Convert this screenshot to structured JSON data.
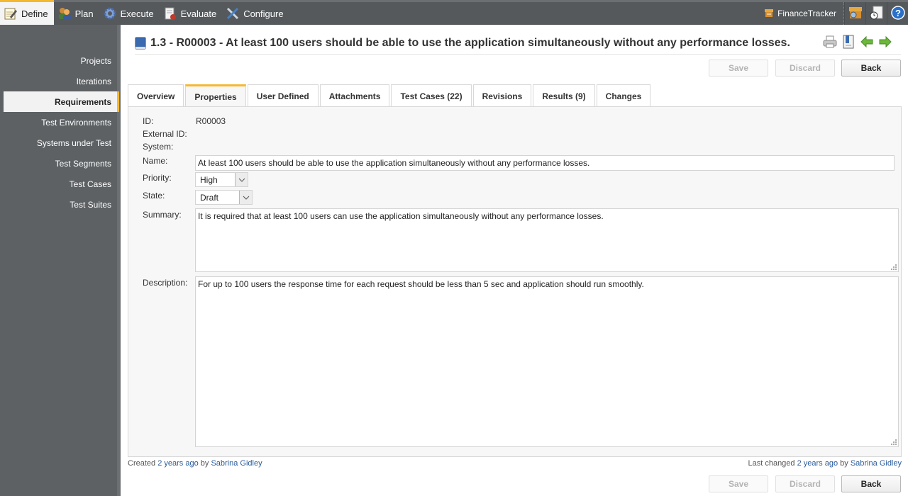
{
  "topnav": {
    "items": [
      {
        "label": "Define",
        "icon": "notepad-pencil-icon",
        "active": true
      },
      {
        "label": "Plan",
        "icon": "people-icon",
        "active": false
      },
      {
        "label": "Execute",
        "icon": "gear-icon",
        "active": false
      },
      {
        "label": "Evaluate",
        "icon": "report-chart-icon",
        "active": false
      },
      {
        "label": "Configure",
        "icon": "tools-icon",
        "active": false
      }
    ],
    "project": "FinanceTracker",
    "right_icons": [
      "project-search-icon",
      "history-document-icon",
      "help-icon"
    ]
  },
  "sidebar": {
    "items": [
      {
        "label": "Projects",
        "active": false
      },
      {
        "label": "Iterations",
        "active": false
      },
      {
        "label": "Requirements",
        "active": true
      },
      {
        "label": "Test Environments",
        "active": false
      },
      {
        "label": "Systems under Test",
        "active": false
      },
      {
        "label": "Test Segments",
        "active": false
      },
      {
        "label": "Test Cases",
        "active": false
      },
      {
        "label": "Test Suites",
        "active": false
      }
    ]
  },
  "header": {
    "title": "1.3 - R00003 - At least 100 users should be able to use the application simultaneously without any performance losses.",
    "tools": [
      "printer-icon",
      "bookmark-document-icon",
      "previous-arrow-icon",
      "next-arrow-icon"
    ]
  },
  "actions": {
    "save": "Save",
    "discard": "Discard",
    "back": "Back"
  },
  "tabs": [
    {
      "label": "Overview",
      "active": false
    },
    {
      "label": "Properties",
      "active": true
    },
    {
      "label": "User Defined",
      "active": false
    },
    {
      "label": "Attachments",
      "active": false
    },
    {
      "label": "Test Cases (22)",
      "active": false
    },
    {
      "label": "Revisions",
      "active": false
    },
    {
      "label": "Results (9)",
      "active": false
    },
    {
      "label": "Changes",
      "active": false
    }
  ],
  "form": {
    "id_label": "ID:",
    "id_value": "R00003",
    "external_id_label": "External ID:",
    "external_id_value": "",
    "system_label": "System:",
    "system_value": "",
    "name_label": "Name:",
    "name_value": "At least 100 users should be able to use the application simultaneously without any performance losses.",
    "priority_label": "Priority:",
    "priority_value": "High",
    "state_label": "State:",
    "state_value": "Draft",
    "summary_label": "Summary:",
    "summary_value": "It is required that at least 100 users can use the application simultaneously without any performance losses.",
    "description_label": "Description:",
    "description_value": "For up to 100 users the response time for each request should be less than 5 sec and application should run smoothly."
  },
  "footer": {
    "created_prefix": "Created",
    "created_when": "2 years ago",
    "created_by_word": "by",
    "created_by": "Sabrina Gidley",
    "changed_prefix": "Last changed",
    "changed_when": "2 years ago",
    "changed_by_word": "by",
    "changed_by": "Sabrina Gidley"
  }
}
